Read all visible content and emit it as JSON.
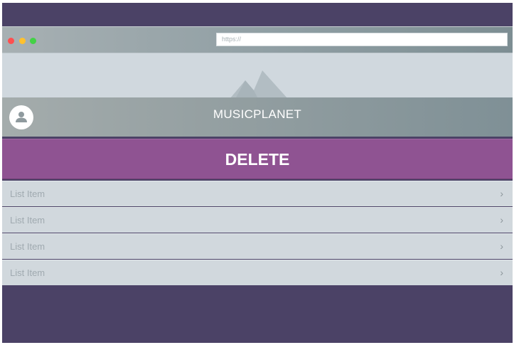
{
  "browser": {
    "url_placeholder": "https://"
  },
  "header": {
    "title": "MUSICPLANET"
  },
  "actions": {
    "delete_label": "DELETE"
  },
  "list": {
    "items": [
      {
        "label": "List Item",
        "chevron": "›"
      },
      {
        "label": "List Item",
        "chevron": "›"
      },
      {
        "label": "List Item",
        "chevron": "›"
      },
      {
        "label": "List Item",
        "chevron": "›"
      }
    ]
  },
  "colors": {
    "background": "#4b4266",
    "accent": "#8f5392",
    "list_bg": "#d1d8dd"
  },
  "icons": {
    "window_controls": [
      "close-dot",
      "minimize-dot",
      "maximize-dot"
    ],
    "hero": "mountain-icon",
    "avatar": "user-icon",
    "list_chevron": "chevron-right-icon"
  }
}
